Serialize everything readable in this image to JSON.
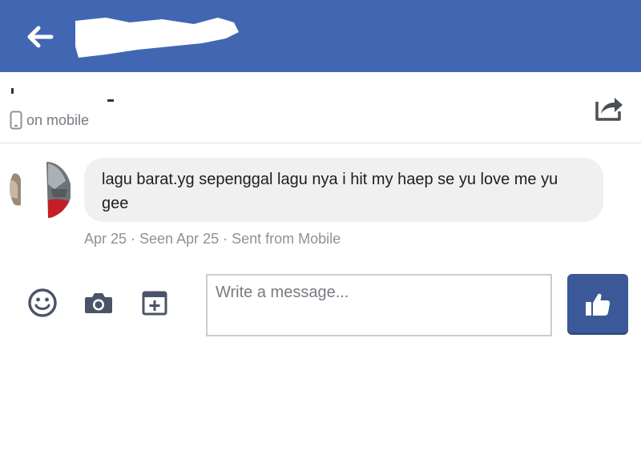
{
  "header": {
    "back_icon": "back-arrow-icon",
    "contact_name_redacted": true
  },
  "contact": {
    "status_icon": "mobile-phone-icon",
    "status_text": "on mobile",
    "share_icon": "share-icon"
  },
  "conversation": {
    "messages": [
      {
        "text": "lagu barat.yg sepenggal lagu nya i hit my haep se yu love me yu gee",
        "meta": "Apr 25 · Seen Apr 25 · Sent from Mobile"
      }
    ]
  },
  "composer": {
    "placeholder": "Write a message...",
    "value": "",
    "emoji_icon": "emoji-icon",
    "camera_icon": "camera-icon",
    "attach_icon": "add-attachment-icon",
    "like_icon": "thumbs-up-icon"
  },
  "colors": {
    "header_bg": "#4267b2",
    "like_button_bg": "#3b5998",
    "bubble_bg": "#f1f0f0"
  }
}
